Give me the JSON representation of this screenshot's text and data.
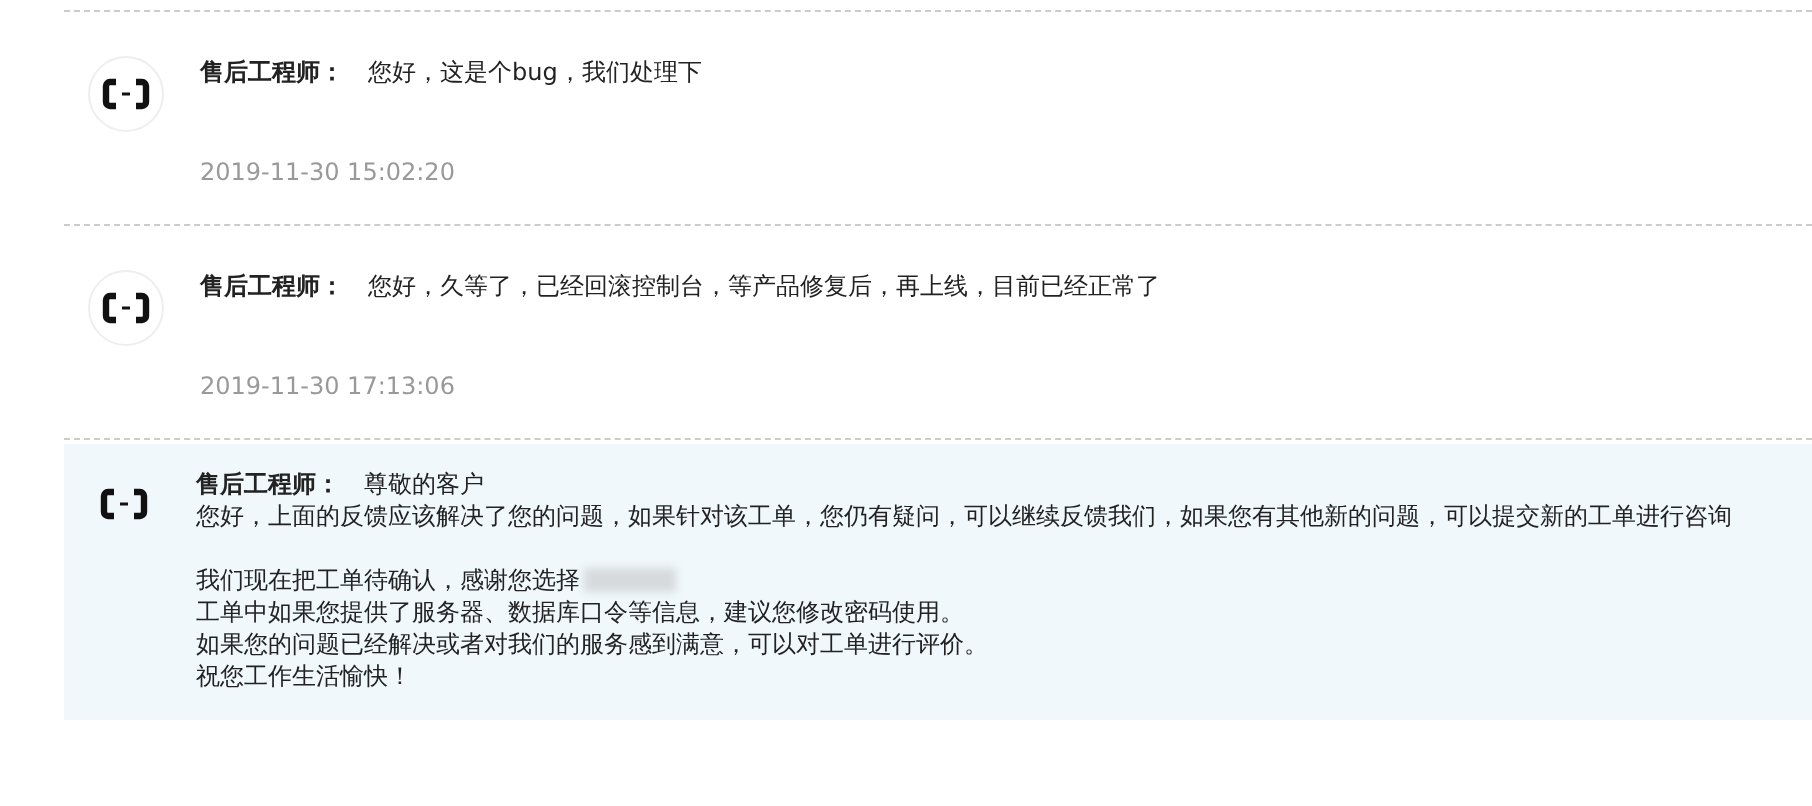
{
  "messages": [
    {
      "sender": "售后工程师：",
      "text": "您好，这是个bug，我们处理下",
      "time": "2019-11-30 15:02:20",
      "highlighted": false
    },
    {
      "sender": "售后工程师：",
      "text": "您好，久等了，已经回滚控制台，等产品修复后，再上线，目前已经正常了",
      "time": "2019-11-30 17:13:06",
      "highlighted": false
    },
    {
      "sender": "售后工程师：",
      "text": "尊敬的客户",
      "paragraphs": [
        [
          {
            "text": "您好，上面的反馈应该解决了您的问题，如果针对该工单，您仍有疑问，可以继续反馈我们，如果您有其他新的问题，可以提交新的工单进行咨询",
            "redacted": false
          }
        ],
        [
          {
            "text": "我们现在把工单待确认，感谢您选择",
            "redacted": true
          },
          {
            "text": "工单中如果您提供了服务器、数据库口令等信息，建议您修改密码使用。",
            "redacted": false
          },
          {
            "text": "如果您的问题已经解决或者对我们的服务感到满意，可以对工单进行评价。",
            "redacted": false
          },
          {
            "text": "祝您工作生活愉快！",
            "redacted": false
          }
        ]
      ],
      "highlighted": true
    }
  ]
}
